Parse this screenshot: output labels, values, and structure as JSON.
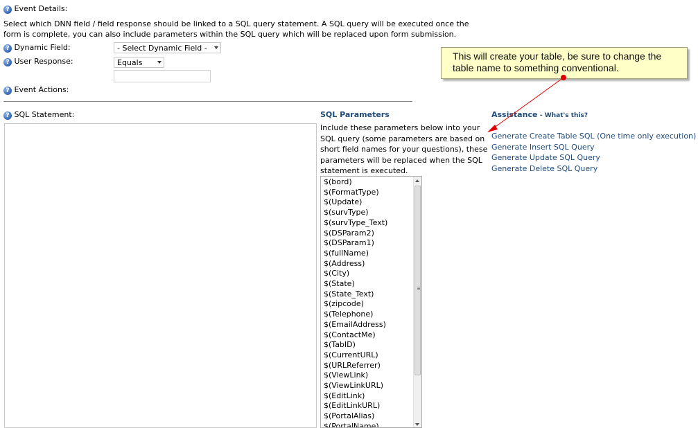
{
  "event_details": {
    "title": "Event Details:",
    "description_line1": "Select which DNN field / field response should be linked to a SQL query statement. A SQL query will be executed once the",
    "description_line2": "form is complete, you can also include parameters within the SQL query which will be replaced upon form submission."
  },
  "dynamic_field": {
    "label": "Dynamic Field:",
    "selected": "- Select Dynamic Field -"
  },
  "user_response": {
    "label": "User Response:",
    "selected": "Equals",
    "value": ""
  },
  "event_actions": {
    "title": "Event Actions:"
  },
  "sql_statement": {
    "label": "SQL Statement:",
    "value": ""
  },
  "sql_parameters": {
    "heading": "SQL Parameters",
    "description_lines": [
      "Include these parameters below into your",
      "SQL query (some parameters are based on",
      "short field names for your questions), these",
      "parameters will be replaced when the SQL",
      "statement is executed."
    ],
    "items": [
      "$(bord)",
      "$(FormatType)",
      "$(Update)",
      "$(survType)",
      "$(survType_Text)",
      "$(DSParam2)",
      "$(DSParam1)",
      "$(fullName)",
      "$(Address)",
      "$(City)",
      "$(State)",
      "$(State_Text)",
      "$(zipcode)",
      "$(Telephone)",
      "$(EmailAddress)",
      "$(ContactMe)",
      "$(TabID)",
      "$(CurrentURL)",
      "$(URLReferrer)",
      "$(ViewLink)",
      "$(ViewLinkURL)",
      "$(EditLink)",
      "$(EditLinkURL)",
      "$(PortalAlias)",
      "$(PortalName)"
    ]
  },
  "assistance": {
    "heading": "Assistance",
    "whats_this": "- What's this?",
    "links": [
      "Generate Create Table SQL (One time only execution)",
      "Generate Insert SQL Query",
      "Generate Update SQL Query",
      "Generate Delete SQL Query"
    ]
  },
  "callout": {
    "line1": "This will create your table, be sure to change the",
    "line2": "table name to something conventional."
  },
  "colors": {
    "link_blue": "#1f4b7a",
    "callout_bg": "#ffffc8",
    "arrow_red": "#e00000"
  }
}
